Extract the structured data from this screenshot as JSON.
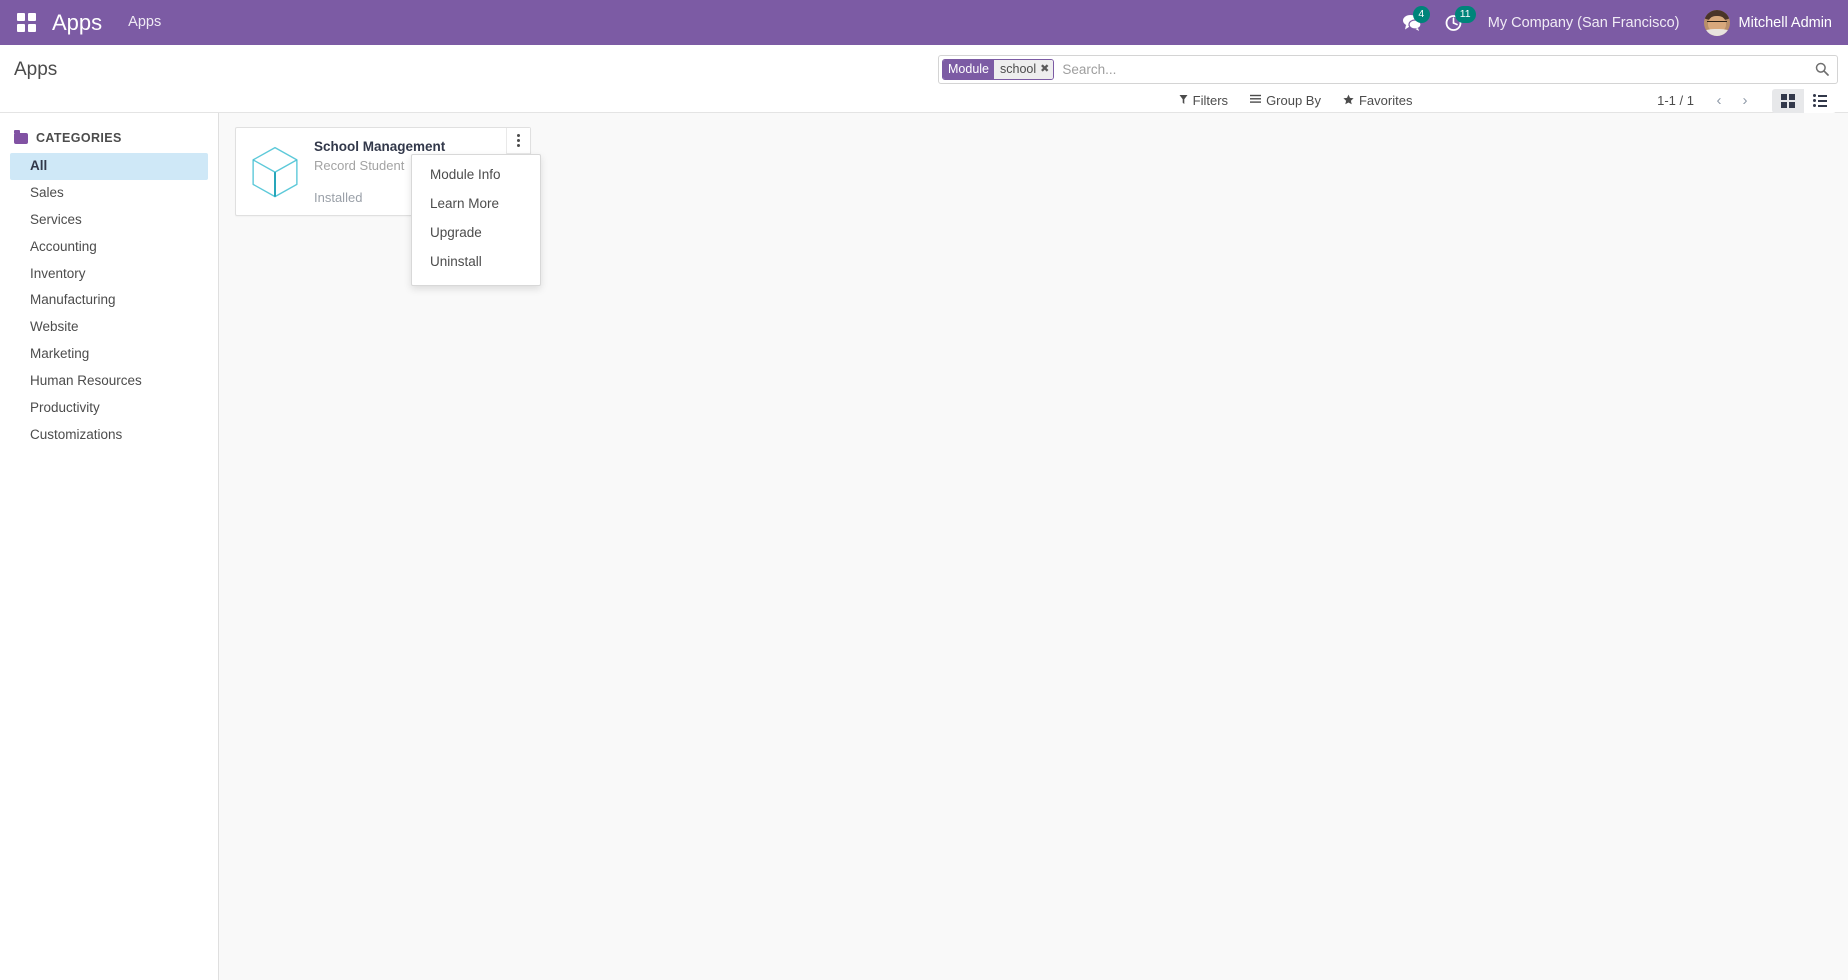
{
  "theme": {
    "navbar_bg": "#7C5BA4",
    "badge_bg": "#00847A",
    "sidebar_active_bg": "#CFE8F7",
    "page_bg": "#F9F9F9",
    "cube_stroke": "#3BBFD0"
  },
  "navbar": {
    "apps_grid_icon": "apps-grid-icon",
    "brand": "Apps",
    "menu_item": "Apps",
    "messages": {
      "icon": "messages-icon",
      "count": "4"
    },
    "activities": {
      "icon": "activities-clock-icon",
      "count": "11"
    },
    "company": "My Company (San Francisco)",
    "avatar_icon": "user-avatar",
    "username": "Mitchell Admin"
  },
  "control_panel": {
    "page_title": "Apps",
    "search": {
      "facet": {
        "label": "Module",
        "value": "school",
        "close_icon": "facet-remove-icon"
      },
      "placeholder": "Search...",
      "value": "",
      "search_icon": "search-icon"
    },
    "buttons": [
      {
        "name": "filters-button",
        "icon": "filter-funnel-icon",
        "glyph": "⚑",
        "label": "Filters"
      },
      {
        "name": "group-by-button",
        "icon": "group-by-bars-icon",
        "glyph": "≡",
        "label": "Group By"
      },
      {
        "name": "favorites-button",
        "icon": "star-icon",
        "glyph": "★",
        "label": "Favorites"
      }
    ],
    "pager": {
      "range": "1-1 / 1",
      "prev_icon": "chevron-left-icon",
      "next_icon": "chevron-right-icon",
      "prev_glyph": "‹",
      "next_glyph": "›"
    },
    "view_switcher": [
      {
        "name": "kanban-view-button",
        "icon": "kanban-grid-icon",
        "active": true
      },
      {
        "name": "list-view-button",
        "icon": "list-view-icon",
        "active": false
      }
    ]
  },
  "sidebar": {
    "header": "CATEGORIES",
    "header_icon": "folder-icon",
    "items": [
      {
        "label": "All",
        "active": true
      },
      {
        "label": "Sales",
        "active": false
      },
      {
        "label": "Services",
        "active": false
      },
      {
        "label": "Accounting",
        "active": false
      },
      {
        "label": "Inventory",
        "active": false
      },
      {
        "label": "Manufacturing",
        "active": false
      },
      {
        "label": "Website",
        "active": false
      },
      {
        "label": "Marketing",
        "active": false
      },
      {
        "label": "Human Resources",
        "active": false
      },
      {
        "label": "Productivity",
        "active": false
      },
      {
        "label": "Customizations",
        "active": false
      }
    ]
  },
  "kanban": {
    "card": {
      "icon": "module-cube-icon",
      "title": "School Management",
      "description": "Record Student",
      "state": "Installed",
      "menu_icon": "kebab-menu-icon"
    },
    "dropdown": {
      "items": [
        {
          "label": "Module Info",
          "name": "dropdown-item-module-info"
        },
        {
          "label": "Learn More",
          "name": "dropdown-item-learn-more"
        },
        {
          "label": "Upgrade",
          "name": "dropdown-item-upgrade"
        },
        {
          "label": "Uninstall",
          "name": "dropdown-item-uninstall"
        }
      ]
    }
  }
}
